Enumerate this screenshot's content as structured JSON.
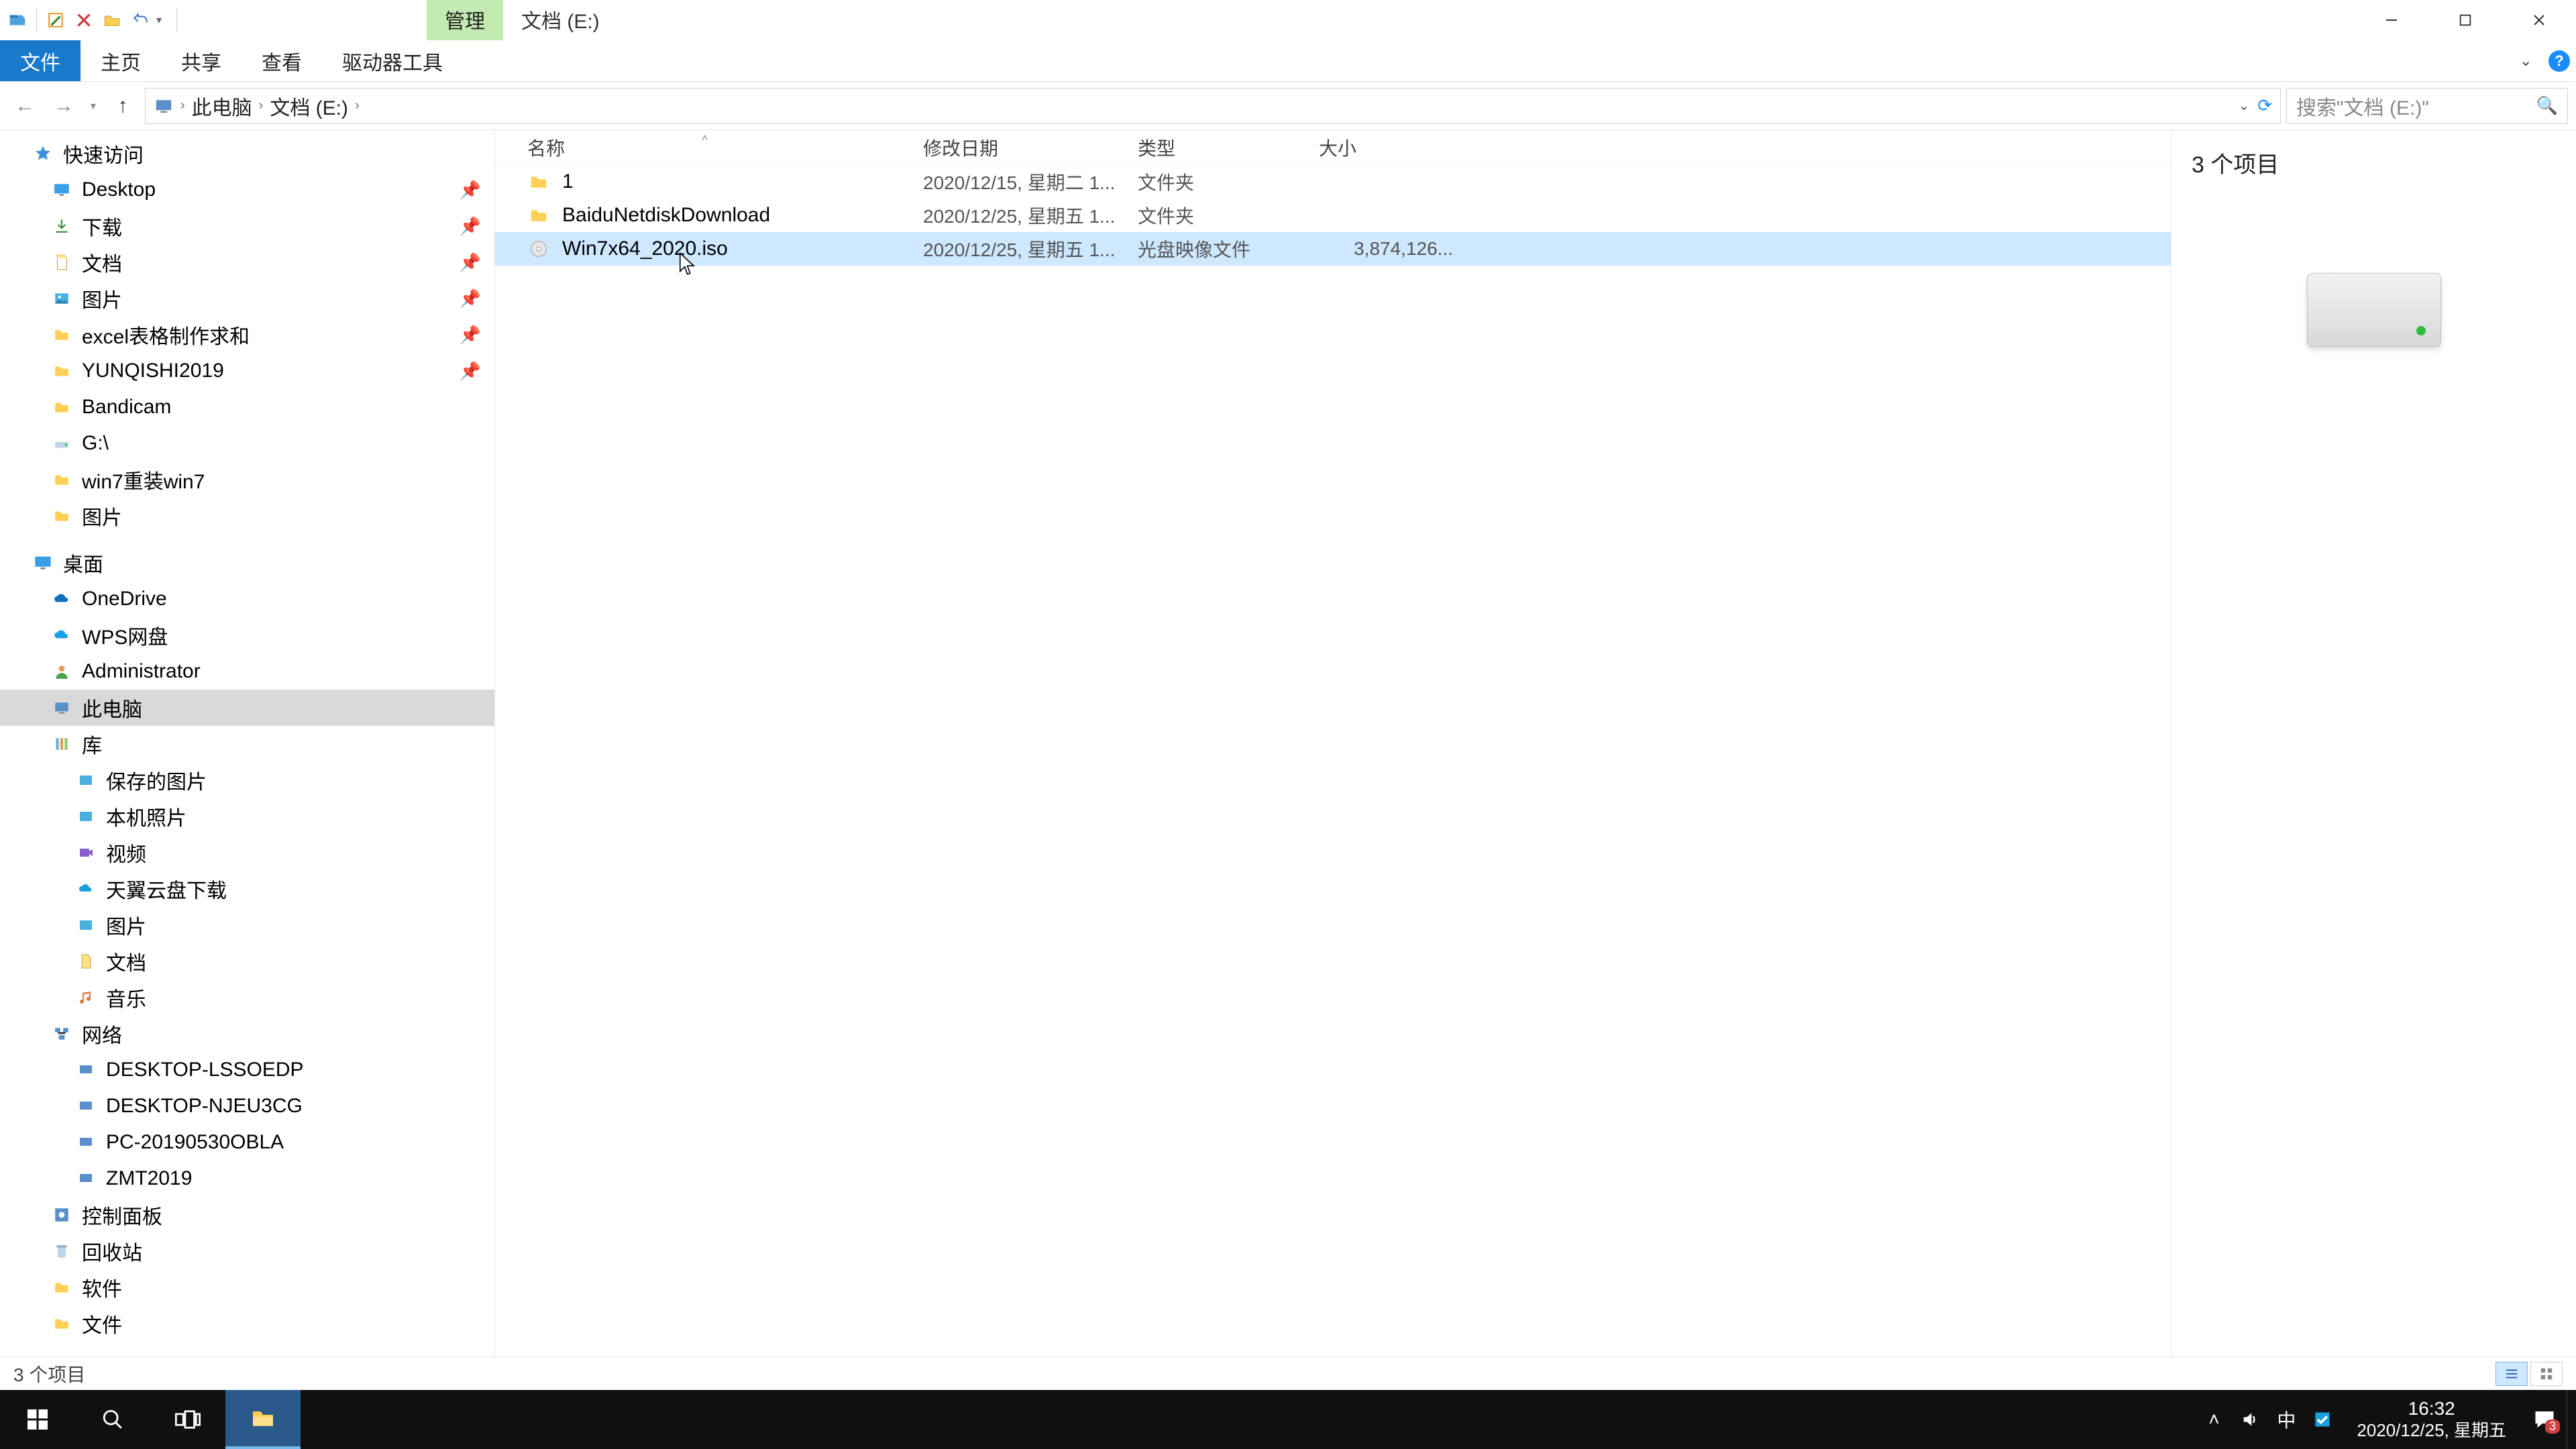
{
  "titlebar": {
    "contextual_tab": "管理",
    "window_title": "文档 (E:)"
  },
  "ribbon": {
    "file": "文件",
    "home": "主页",
    "share": "共享",
    "view": "查看",
    "drive_tools": "驱动器工具"
  },
  "address": {
    "root": "此电脑",
    "current": "文档 (E:)",
    "search_placeholder": "搜索\"文档 (E:)\""
  },
  "nav": {
    "quick_access": "快速访问",
    "desktop": "Desktop",
    "downloads": "下载",
    "documents": "文档",
    "pictures": "图片",
    "excel_folder": "excel表格制作求和",
    "yunqishi": "YUNQISHI2019",
    "bandicam": "Bandicam",
    "gdrive": "G:\\",
    "win7reinstall": "win7重装win7",
    "pictures2": "图片",
    "desktop_group": "桌面",
    "onedrive": "OneDrive",
    "wps": "WPS网盘",
    "administrator": "Administrator",
    "this_pc": "此电脑",
    "libraries": "库",
    "saved_pictures": "保存的图片",
    "camera_roll": "本机照片",
    "videos": "视频",
    "tianyi": "天翼云盘下载",
    "pictures3": "图片",
    "documents2": "文档",
    "music": "音乐",
    "network": "网络",
    "pc1": "DESKTOP-LSSOEDP",
    "pc2": "DESKTOP-NJEU3CG",
    "pc3": "PC-20190530OBLA",
    "pc4": "ZMT2019",
    "control_panel": "控制面板",
    "recycle_bin": "回收站",
    "software": "软件",
    "files": "文件"
  },
  "columns": {
    "name": "名称",
    "date": "修改日期",
    "type": "类型",
    "size": "大小"
  },
  "rows": [
    {
      "name": "1",
      "date": "2020/12/15, 星期二 1...",
      "type": "文件夹",
      "size": "",
      "icon": "folder"
    },
    {
      "name": "BaiduNetdiskDownload",
      "date": "2020/12/25, 星期五 1...",
      "type": "文件夹",
      "size": "",
      "icon": "folder"
    },
    {
      "name": "Win7x64_2020.iso",
      "date": "2020/12/25, 星期五 1...",
      "type": "光盘映像文件",
      "size": "3,874,126...",
      "icon": "iso",
      "selected": true
    }
  ],
  "preview": {
    "count_label": "3 个项目"
  },
  "statusbar": {
    "items": "3 个项目"
  },
  "taskbar": {
    "time": "16:32",
    "date": "2020/12/25, 星期五",
    "ime": "中",
    "notif_badge": "3"
  }
}
